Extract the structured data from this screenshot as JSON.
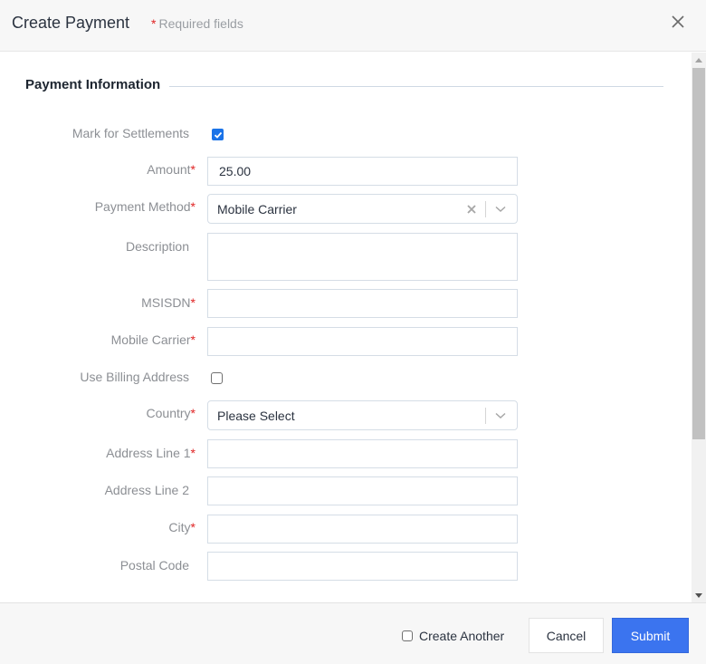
{
  "header": {
    "title": "Create Payment",
    "required_marker": "*",
    "required_note": "Required fields"
  },
  "section": {
    "title": "Payment Information"
  },
  "form": {
    "mark_for_settlements": {
      "label": "Mark for Settlements",
      "checked": true
    },
    "amount": {
      "label": "Amount",
      "required": "*",
      "value": "25.00"
    },
    "payment_method": {
      "label": "Payment Method",
      "required": "*",
      "value": "Mobile Carrier"
    },
    "description": {
      "label": "Description",
      "value": ""
    },
    "msisdn": {
      "label": "MSISDN",
      "required": "*",
      "value": ""
    },
    "mobile_carrier": {
      "label": "Mobile Carrier",
      "required": "*",
      "value": ""
    },
    "use_billing_address": {
      "label": "Use Billing Address",
      "checked": false
    },
    "country": {
      "label": "Country",
      "required": "*",
      "placeholder": "Please Select"
    },
    "address_line_1": {
      "label": "Address Line 1",
      "required": "*",
      "value": ""
    },
    "address_line_2": {
      "label": "Address Line 2",
      "value": ""
    },
    "city": {
      "label": "City",
      "required": "*",
      "value": ""
    },
    "postal_code": {
      "label": "Postal Code",
      "value": ""
    }
  },
  "footer": {
    "create_another_label": "Create Another",
    "create_another_checked": false,
    "cancel_label": "Cancel",
    "submit_label": "Submit"
  },
  "colors": {
    "primary": "#3b74ef",
    "required": "#e02424",
    "checkbox_checked": "#1a73e8"
  }
}
